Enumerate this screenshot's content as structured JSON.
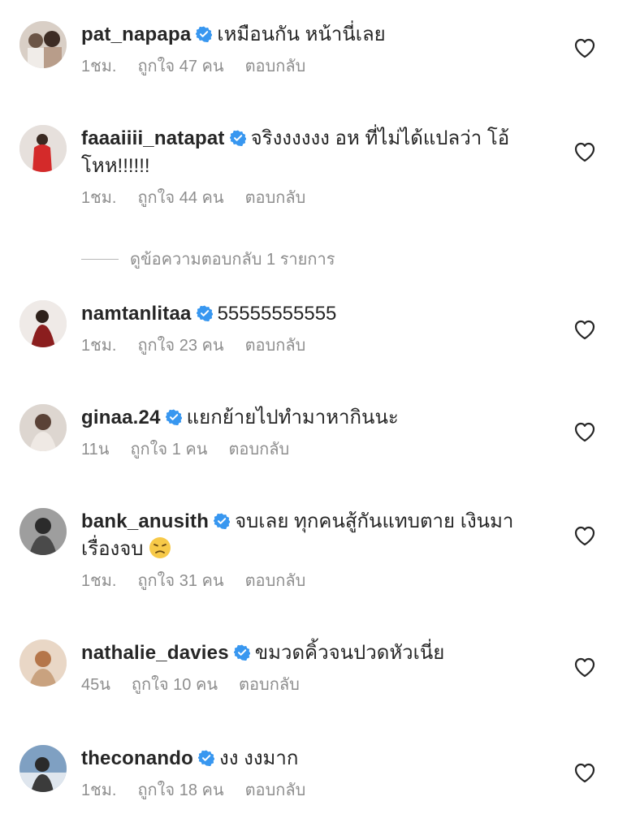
{
  "comments": [
    {
      "username": "pat_napapa",
      "text": "เหมือนกัน หน้านี่เลย",
      "time": "1ชม.",
      "likes": "ถูกใจ 47 คน",
      "reply": "ตอบกลับ",
      "avatar_color": "#c9b8a8"
    },
    {
      "username": "faaaiiii_natapat",
      "text": "จริงงงงงง อห ที่ไม่ได้แปลว่า โอ้โหห!!!!!!",
      "time": "1ชม.",
      "likes": "ถูกใจ 44 คน",
      "reply": "ตอบกลับ",
      "avatar_color": "#d8cfc9"
    },
    {
      "username": "namtanlitaa",
      "text": "55555555555",
      "time": "1ชม.",
      "likes": "ถูกใจ 23 คน",
      "reply": "ตอบกลับ",
      "avatar_color": "#8a6f62"
    },
    {
      "username": "ginaa.24",
      "text": "แยกย้ายไปทำมาหากินนะ",
      "time": "11น",
      "likes": "ถูกใจ 1 คน",
      "reply": "ตอบกลับ",
      "avatar_color": "#bfb4ab"
    },
    {
      "username": "bank_anusith",
      "text": "จบเลย ทุกคนสู้กันแทบตาย เงินมาเรื่องจบ",
      "time": "1ชม.",
      "likes": "ถูกใจ 31 คน",
      "reply": "ตอบกลับ",
      "avatar_color": "#8c8c8c"
    },
    {
      "username": "nathalie_davies",
      "text": "ขมวดคิ้วจนปวดหัวเนี่ย",
      "time": "45น",
      "likes": "ถูกใจ 10 คน",
      "reply": "ตอบกลับ",
      "avatar_color": "#c7a189"
    },
    {
      "username": "theconando",
      "text": "งง งงมาก",
      "time": "1ชม.",
      "likes": "ถูกใจ 18 คน",
      "reply": "ตอบกลับ",
      "avatar_color": "#5d7a99"
    }
  ],
  "comment2_line1": "จริงงงงงง อห ที่ไม่ได้แปลว่า โอ้",
  "comment2_line2": "โหห!!!!!!",
  "comment5_line1": "จบเลย ทุกคนสู้กันแทบตาย เงินมา",
  "comment5_line2": "เรื่องจบ",
  "view_replies": "ดูข้อความตอบกลับ 1 รายการ",
  "colors": {
    "verified": "#3897f0",
    "secondary_text": "#8e8e8e",
    "primary_text": "#262626"
  },
  "icons": {
    "verified": "verified-badge-icon",
    "heart": "heart-outline-icon",
    "emoji": "disappointed-face-emoji"
  }
}
